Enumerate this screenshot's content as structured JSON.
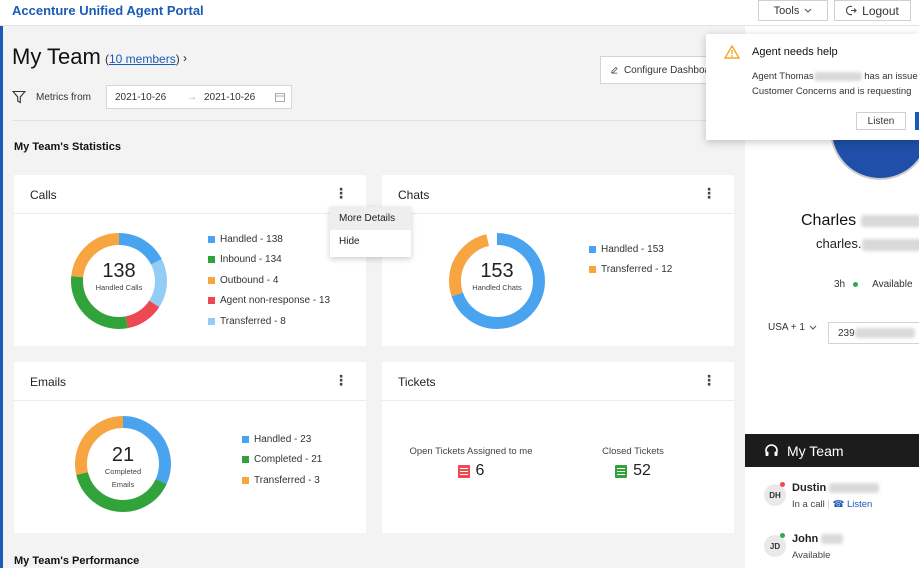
{
  "app": {
    "title": "Accenture Unified Agent Portal"
  },
  "topbar": {
    "tools_label": "Tools",
    "logout_label": "Logout"
  },
  "header": {
    "title": "My Team",
    "members_link": "10 members",
    "metrics_label": "Metrics from",
    "date_from": "2021-10-26",
    "date_to": "2021-10-26",
    "configure_label": "Configure Dashboard"
  },
  "sections": {
    "statistics": "My Team's Statistics",
    "performance": "My Team's Performance"
  },
  "cards": {
    "calls": {
      "title": "Calls",
      "center_value": "138",
      "center_label": "Handled Calls",
      "legend": [
        {
          "label": "Handled - 138",
          "color": "#4aa3ef"
        },
        {
          "label": "Inbound - 134",
          "color": "#32a23a"
        },
        {
          "label": "Outbound - 4",
          "color": "#f7a541"
        },
        {
          "label": "Agent non-response - 13",
          "color": "#ee4952"
        },
        {
          "label": "Transferred - 8",
          "color": "#93cdf5"
        }
      ]
    },
    "chats": {
      "title": "Chats",
      "center_value": "153",
      "center_label": "Handled Chats",
      "legend": [
        {
          "label": "Handled - 153",
          "color": "#4aa3ef"
        },
        {
          "label": "Transferred - 12",
          "color": "#f7a541"
        }
      ]
    },
    "emails": {
      "title": "Emails",
      "center_value": "21",
      "center_label_1": "Completed",
      "center_label_2": "Emails",
      "legend": [
        {
          "label": "Handled - 23",
          "color": "#4aa3ef"
        },
        {
          "label": "Completed - 21",
          "color": "#32a23a"
        },
        {
          "label": "Transferred - 3",
          "color": "#f7a541"
        }
      ]
    },
    "tickets": {
      "title": "Tickets",
      "open_label": "Open Tickets Assigned to me",
      "open_value": "6",
      "open_color": "#ee4952",
      "closed_label": "Closed Tickets",
      "closed_value": "52",
      "closed_color": "#32a23a"
    }
  },
  "menu": {
    "items": [
      "More Details",
      "Hide"
    ]
  },
  "profile": {
    "name": "Charles",
    "email": "charles.",
    "duration": "3h",
    "status": "Available",
    "country_code": "USA + 1",
    "phone_prefix": "239"
  },
  "my_team": {
    "title": "My Team",
    "members": [
      {
        "initials": "DH",
        "name": "Dustin",
        "status": "In a call",
        "listen": "Listen",
        "dot": "#ee4952"
      },
      {
        "initials": "JD",
        "name": "John",
        "status": "Available",
        "dot": "#2fa84f"
      }
    ]
  },
  "notification": {
    "title": "Agent needs help",
    "line1_start": "Agent Thomas",
    "line1_end": "has an issue",
    "line2": "Customer Concerns and is requesting",
    "listen_label": "Listen"
  }
}
